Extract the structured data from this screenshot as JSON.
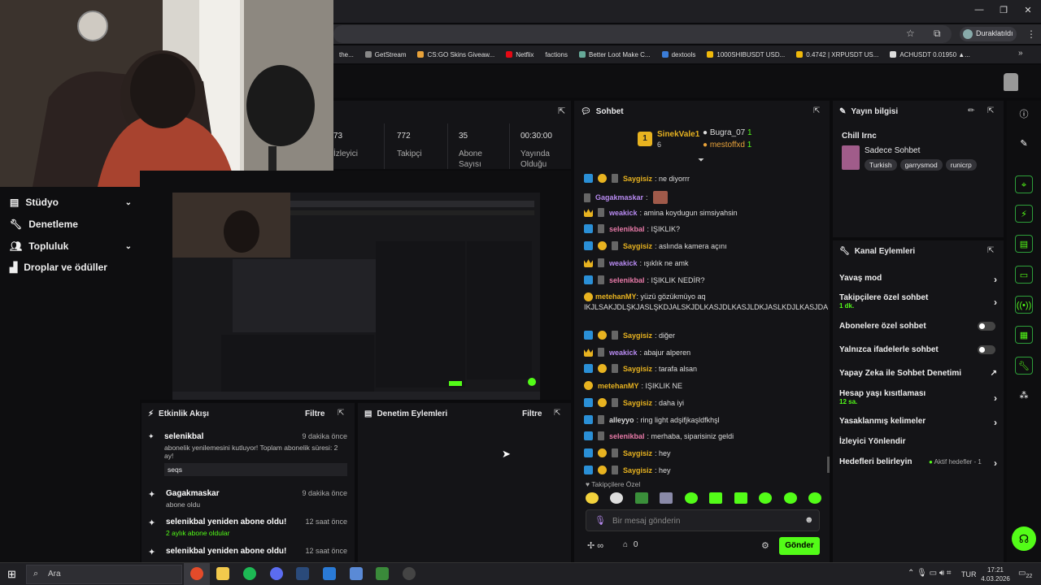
{
  "browser": {
    "profile": "Duraklatıldı",
    "bookmarks": [
      "the...",
      "GetStream",
      "CS:GO Skins Giveaw...",
      "Netflix",
      "factions",
      "Better Loot Make C...",
      "dextools",
      "1000SHIBUSDT USD...",
      "0.4742 | XRPUSDT US...",
      "ACHUSDT 0.01950 ▲..."
    ]
  },
  "sidebar": {
    "items": [
      {
        "label": "Stüdyo",
        "icon": "studio-icon"
      },
      {
        "label": "Denetleme",
        "icon": "wrench-icon"
      },
      {
        "label": "Topluluk",
        "icon": "people-icon"
      },
      {
        "label": "Droplar ve ödüller",
        "icon": "gift-icon"
      }
    ]
  },
  "stats": [
    {
      "value": "73",
      "label": "İzleyici"
    },
    {
      "value": "772",
      "label": "Takipçi"
    },
    {
      "value": "35",
      "label": "Abone Sayısı"
    },
    {
      "value": "00:30:00",
      "label": "Yayında Olduğu"
    }
  ],
  "activity": {
    "title": "Etkinlik Akışı",
    "filter": "Filtre",
    "items": [
      {
        "name": "selenikbal",
        "time": "9 dakika önce",
        "text": "abonelik yenilemesini kutluyor! Toplam abonelik süresi: 2 ay!",
        "msg": "seqs"
      },
      {
        "name": "Gagakmaskar",
        "time": "9 dakika önce",
        "text": "abone oldu"
      },
      {
        "name": "selenikbal yeniden abone oldu!",
        "time": "12 saat önce",
        "text": "2 aylık abone oldular"
      },
      {
        "name": "selenikbal yeniden abone oldu!",
        "time": "12 saat önce",
        "text": ""
      }
    ]
  },
  "moderation": {
    "title": "Denetim Eylemleri",
    "filter": "Filtre"
  },
  "chat": {
    "title": "Sohbet",
    "top_supporters": {
      "first": "SinekVale1",
      "first_count": "6",
      "second": "Bugra_07",
      "second_count": "1",
      "third": "mestoffxd",
      "third_count": "1"
    },
    "messages": [
      {
        "user": "Saygisiz",
        "color": "#e8b320",
        "text": ": ne diyorrr"
      },
      {
        "user": "Gagakmaskar",
        "color": "#b78af0",
        "text": ":"
      },
      {
        "user": "weakick",
        "color": "#b78af0",
        "text": ": amina koydugun simsiyahsin"
      },
      {
        "user": "selenikbal",
        "color": "#e87aa8",
        "text": ": IŞIKLIK?"
      },
      {
        "user": "Saygisiz",
        "color": "#e8b320",
        "text": ": aslında kamera açını"
      },
      {
        "user": "weakick",
        "color": "#b78af0",
        "text": ": ışıklık ne amk"
      },
      {
        "user": "selenikbal",
        "color": "#e87aa8",
        "text": ": IŞIKLIK NEDİR?"
      },
      {
        "user": "metehanMY",
        "color": "#e8b320",
        "text": ": yüzü gözükmüyo aq IKJLSAKJDLŞKJASLŞKDJALSKJDLKASJDLKASJLDKJASLKDJLKASJDA"
      },
      {
        "user": "Saygisiz",
        "color": "#e8b320",
        "text": ": diğer"
      },
      {
        "user": "weakick",
        "color": "#b78af0",
        "text": ": abajur alperen"
      },
      {
        "user": "Saygisiz",
        "color": "#e8b320",
        "text": ": tarafa alsan"
      },
      {
        "user": "metehanMY",
        "color": "#e8b320",
        "text": ": IŞIKLIK NE"
      },
      {
        "user": "Saygisiz",
        "color": "#e8b320",
        "text": ": daha iyi"
      },
      {
        "user": "alleyyo",
        "color": "#ddd",
        "text": ": ring light adşifjkaşldfkhşl"
      },
      {
        "user": "selenikbal",
        "color": "#e87aa8",
        "text": ": merhaba, siparisiniz geldi"
      },
      {
        "user": "Saygisiz",
        "color": "#e8b320",
        "text": ": hey"
      },
      {
        "user": "Saygisiz",
        "color": "#e8b320",
        "text": ": hey"
      }
    ],
    "follower_only": "Takipçilere Özel",
    "input_placeholder": "Bir mesaj gönderin",
    "infinity": "∞",
    "count": "0",
    "send": "Gönder"
  },
  "stream_info": {
    "title": "Yayın bilgisi",
    "stream_title": "Chill Irnc",
    "category": "Sadece Sohbet",
    "tags": [
      "Turkish",
      "garrysmod",
      "runicrp"
    ]
  },
  "channel_actions": {
    "title": "Kanal Eylemleri",
    "rows": [
      {
        "label": "Yavaş mod",
        "sub": "",
        "control": "arrow"
      },
      {
        "label": "Takipçilere özel sohbet",
        "sub": "1 dk.",
        "control": "arrow"
      },
      {
        "label": "Abonelere özel sohbet",
        "sub": "",
        "control": "toggle"
      },
      {
        "label": "Yalnızca ifadelerle sohbet",
        "sub": "",
        "control": "toggle"
      },
      {
        "label": "Yapay Zeka ile Sohbet Denetimi",
        "sub": "",
        "control": "external"
      },
      {
        "label": "Hesap yaşı kısıtlaması",
        "sub": "12 sa.",
        "control": "arrow"
      },
      {
        "label": "Yasaklanmış kelimeler",
        "sub": "",
        "control": "arrow"
      },
      {
        "label": "İzleyici Yönlendir",
        "sub": "",
        "control": "none"
      },
      {
        "label": "Hedefleri belirleyin",
        "sub": "",
        "control": "arrow",
        "note": "Aktif hedefler - 1"
      }
    ]
  },
  "taskbar": {
    "search": "Ara",
    "lang": "TUR",
    "time": "17:21",
    "date": "4.03.2026",
    "notif": "22"
  },
  "colors": {
    "accent": "#53fc18",
    "panel": "#141417"
  }
}
